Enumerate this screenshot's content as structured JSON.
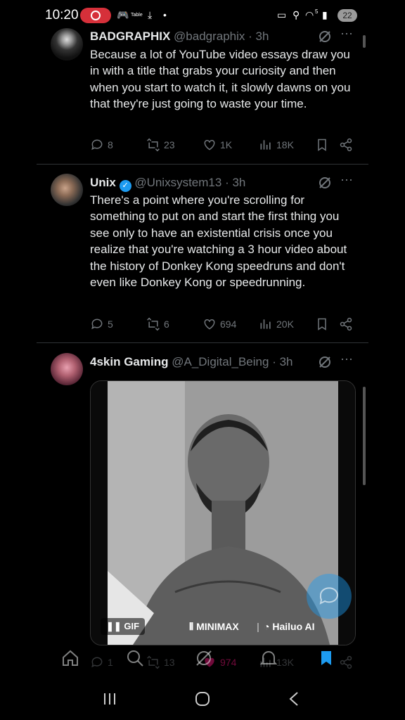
{
  "status_bar": {
    "time": "10:20",
    "notif_text": "Table",
    "signal_label": "5",
    "battery": "22"
  },
  "tweets": [
    {
      "name": "BADGRAPHIX",
      "handle": "@badgraphix",
      "time": "· 3h",
      "verified": false,
      "text": "Because a lot of YouTube video essays draw you in with a title that grabs your curiosity and then when you start to watch it, it slowly dawns on you that they're just going to waste your time.",
      "replies": "8",
      "reposts": "23",
      "likes": "1K",
      "views": "18K"
    },
    {
      "name": "Unix",
      "handle": "@Unixsystem13",
      "time": "· 3h",
      "verified": true,
      "text": "There's a point where you're scrolling for something to put on and start the first thing you see only to have an existential crisis once you realize that you're watching a 3 hour video about the history of Donkey Kong speedruns and don't even like Donkey Kong or speedrunning.",
      "replies": "5",
      "reposts": "6",
      "likes": "694",
      "views": "20K"
    },
    {
      "name": "4skin Gaming",
      "handle": "@A_Digital_Being",
      "time": "· 3h",
      "verified": false,
      "media_badge": "GIF",
      "watermark_left": "MINIMAX",
      "watermark_right": "Hailuo AI",
      "replies": "1",
      "reposts": "13",
      "likes": "974",
      "views": "13K"
    }
  ],
  "colors": {
    "background": "#000000",
    "text": "#e7e9ea",
    "muted": "#71767b",
    "accent": "#1d9bf0",
    "like_active": "#f91880"
  },
  "icons": [
    "reply-icon",
    "repost-icon",
    "like-icon",
    "views-icon",
    "bookmark-icon",
    "share-icon",
    "grok-icon",
    "more-icon",
    "home-icon",
    "search-icon",
    "notifications-icon",
    "bookmarks-tab-icon"
  ]
}
